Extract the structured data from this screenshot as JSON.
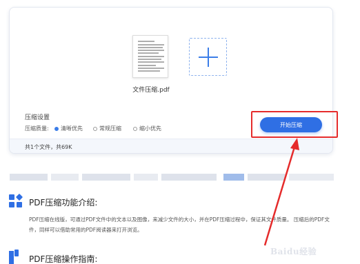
{
  "upload_card": {
    "file_name": "文件压缩.pdf",
    "settings_title": "压缩设置",
    "quality_label": "压缩质量:",
    "options": [
      {
        "label": "清晰优先",
        "selected": true
      },
      {
        "label": "常规压缩",
        "selected": false
      },
      {
        "label": "缩小优先",
        "selected": false
      }
    ],
    "start_button": "开始压缩",
    "file_count": "共1个文件，共69K"
  },
  "intro": {
    "title": "PDF压缩功能介绍:",
    "body": "PDF压缩在线版，可通过PDF文件中的文本以及图像，来减少文件的大小，并在PDF压缩过程中，保证其文件质量。 压缩后的PDF文件，同样可以借助常用的PDF阅读器来打开浏览。"
  },
  "guide": {
    "title": "PDF压缩操作指南:"
  },
  "watermark": "Baidu经验",
  "colors": {
    "accent": "#2f6fe4",
    "highlight_box": "#e52b2b"
  }
}
